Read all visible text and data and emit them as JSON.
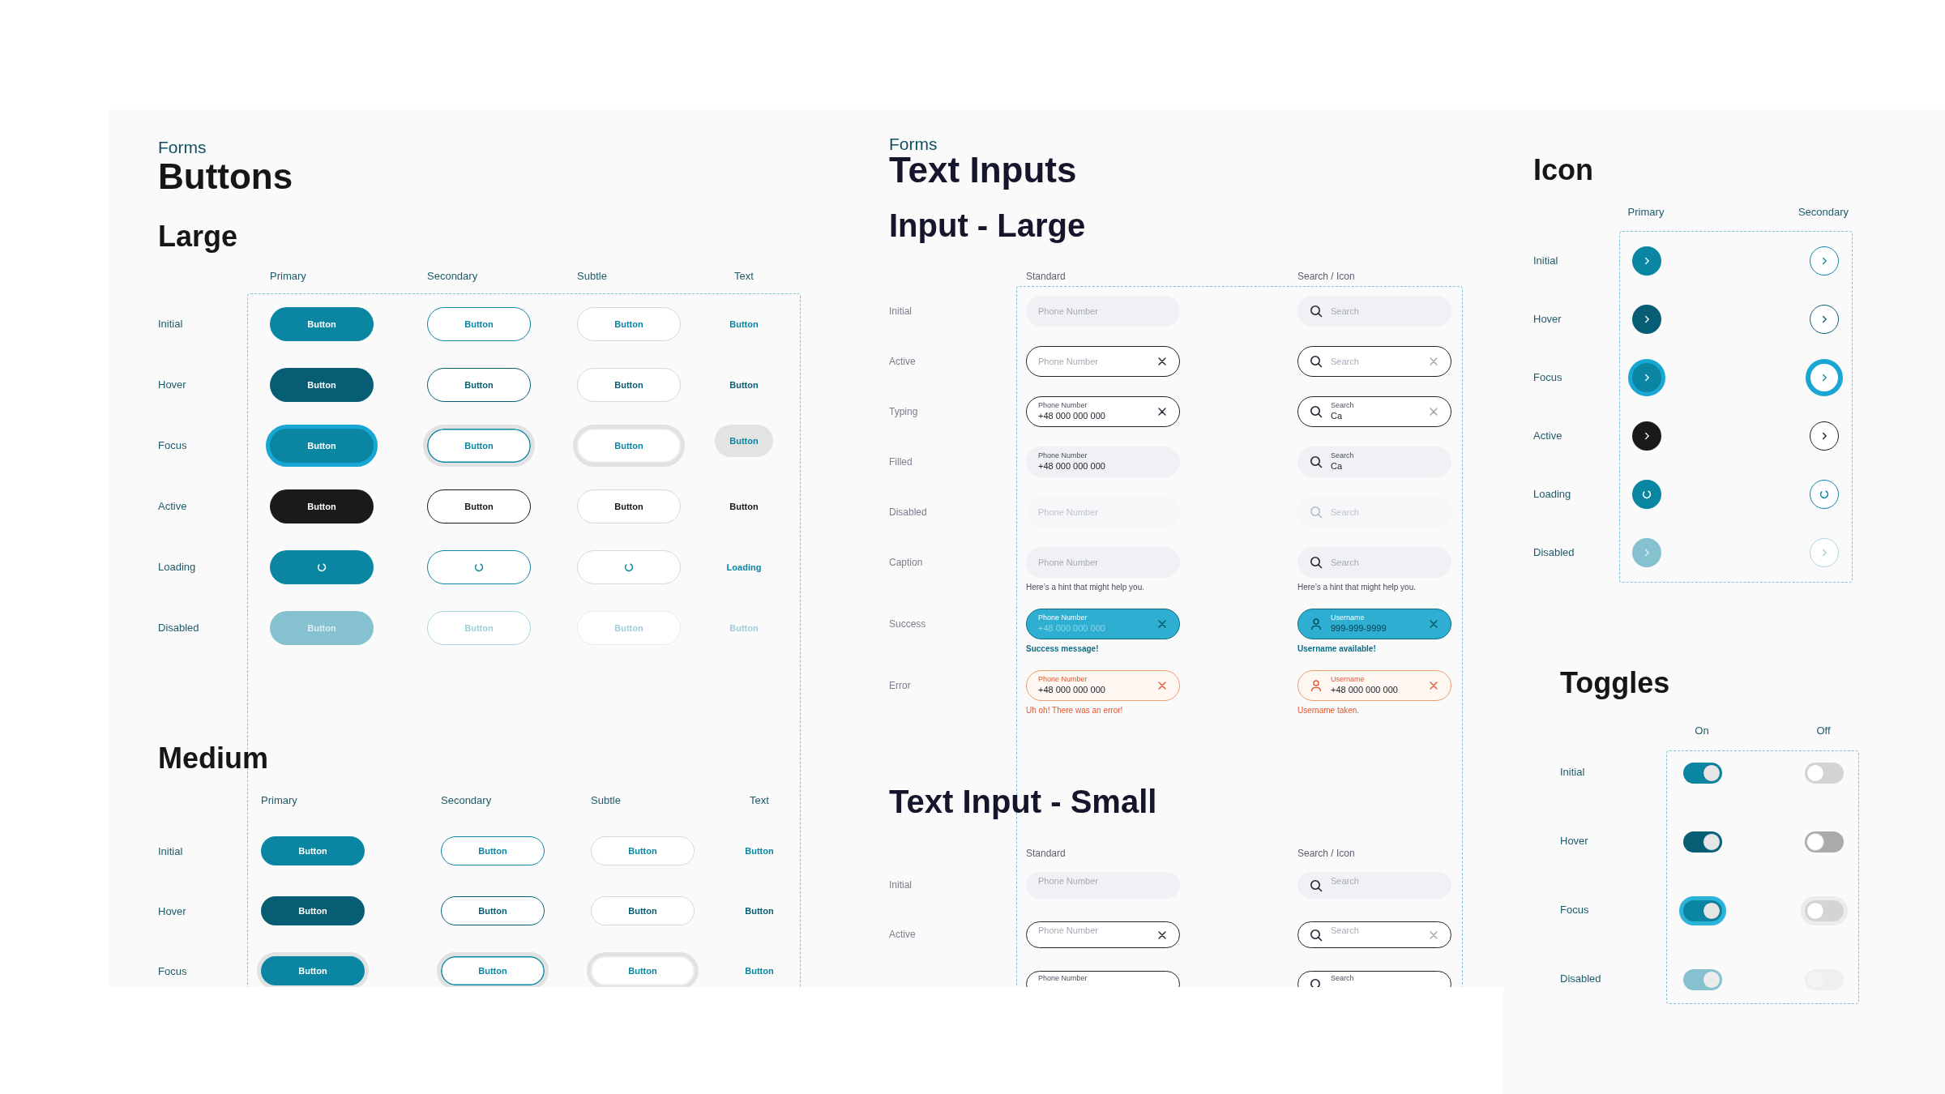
{
  "buttons": {
    "eyebrow": "Forms",
    "title": "Buttons",
    "sizes": [
      {
        "kind": "large",
        "title": "Large",
        "columns": [
          "Primary",
          "Secondary",
          "Subtle",
          "Text"
        ],
        "rows": [
          {
            "kind": "initial",
            "label": "Initial",
            "cells": [
              {
                "kind": "primary",
                "text": "Button"
              },
              {
                "kind": "secondary",
                "text": "Button"
              },
              {
                "kind": "subtle",
                "text": "Button"
              },
              {
                "kind": "text",
                "text": "Button"
              }
            ]
          },
          {
            "kind": "hover",
            "label": "Hover",
            "cells": [
              {
                "kind": "primary",
                "text": "Button"
              },
              {
                "kind": "secondary",
                "text": "Button"
              },
              {
                "kind": "subtle",
                "text": "Button"
              },
              {
                "kind": "text",
                "text": "Button"
              }
            ]
          },
          {
            "kind": "focus",
            "label": "Focus",
            "cells": [
              {
                "kind": "primary",
                "text": "Button"
              },
              {
                "kind": "secondary",
                "text": "Button"
              },
              {
                "kind": "subtle",
                "text": "Button"
              },
              {
                "kind": "text",
                "text": "Button"
              }
            ]
          },
          {
            "kind": "active",
            "label": "Active",
            "cells": [
              {
                "kind": "primary",
                "text": "Button"
              },
              {
                "kind": "secondary",
                "text": "Button"
              },
              {
                "kind": "subtle",
                "text": "Button"
              },
              {
                "kind": "text",
                "text": "Button"
              }
            ]
          },
          {
            "kind": "loading",
            "label": "Loading",
            "cells": [
              {
                "kind": "primary"
              },
              {
                "kind": "secondary"
              },
              {
                "kind": "subtle"
              },
              {
                "kind": "text",
                "text": "Loading"
              }
            ]
          },
          {
            "kind": "disabled",
            "label": "Disabled",
            "cells": [
              {
                "kind": "primary",
                "text": "Button"
              },
              {
                "kind": "secondary",
                "text": "Button"
              },
              {
                "kind": "subtle",
                "text": "Button"
              },
              {
                "kind": "text",
                "text": "Button"
              }
            ]
          }
        ]
      },
      {
        "kind": "medium",
        "title": "Medium",
        "columns": [
          "Primary",
          "Secondary",
          "Subtle",
          "Text"
        ],
        "rows": [
          {
            "kind": "initial",
            "label": "Initial",
            "cells": [
              {
                "kind": "primary",
                "text": "Button"
              },
              {
                "kind": "secondary",
                "text": "Button"
              },
              {
                "kind": "subtle",
                "text": "Button"
              },
              {
                "kind": "text",
                "text": "Button"
              }
            ]
          },
          {
            "kind": "hover",
            "label": "Hover",
            "cells": [
              {
                "kind": "primary",
                "text": "Button"
              },
              {
                "kind": "secondary",
                "text": "Button"
              },
              {
                "kind": "subtle",
                "text": "Button"
              },
              {
                "kind": "text",
                "text": "Button"
              }
            ]
          },
          {
            "kind": "focus",
            "label": "Focus",
            "cells": [
              {
                "kind": "primary",
                "text": "Button"
              },
              {
                "kind": "secondary",
                "text": "Button"
              },
              {
                "kind": "subtle",
                "text": "Button"
              },
              {
                "kind": "text",
                "text": "Button"
              }
            ]
          }
        ]
      }
    ]
  },
  "text_inputs": {
    "eyebrow": "Forms",
    "title": "Text Inputs",
    "sections": [
      {
        "kind": "large",
        "title": "Input - Large",
        "columns": [
          "Standard",
          "Search / Icon"
        ],
        "rows": [
          {
            "kind": "initial",
            "label": "Initial",
            "cells": [
              {
                "kind": "plain",
                "placeholder": "Phone Number",
                "clearable": false
              },
              {
                "kind": "search",
                "placeholder": "Search",
                "clearable": false
              }
            ]
          },
          {
            "kind": "active",
            "label": "Active",
            "cells": [
              {
                "kind": "plain",
                "placeholder": "Phone Number",
                "clearable": true
              },
              {
                "kind": "search",
                "placeholder": "Search",
                "clearable": true
              }
            ]
          },
          {
            "kind": "typing",
            "label": "Typing",
            "cells": [
              {
                "kind": "plain",
                "label": "Phone Number",
                "value": "+48 000 000 000",
                "clearable": true
              },
              {
                "kind": "search",
                "label": "Search",
                "value": "Ca",
                "clearable": true
              }
            ]
          },
          {
            "kind": "filled",
            "label": "Filled",
            "cells": [
              {
                "kind": "plain",
                "label": "Phone Number",
                "value": "+48 000 000 000",
                "clearable": false
              },
              {
                "kind": "search",
                "label": "Search",
                "value": "Ca",
                "clearable": false
              }
            ]
          },
          {
            "kind": "disabled",
            "label": "Disabled",
            "cells": [
              {
                "kind": "plain",
                "placeholder": "Phone Number",
                "clearable": false
              },
              {
                "kind": "search",
                "placeholder": "Search",
                "clearable": false
              }
            ]
          },
          {
            "kind": "caption",
            "label": "Caption",
            "cells": [
              {
                "kind": "plain",
                "placeholder": "Phone Number",
                "clearable": false,
                "hint": "Here’s a hint that might help you."
              },
              {
                "kind": "search",
                "placeholder": "Search",
                "clearable": false,
                "hint": "Here’s a hint that might help you."
              }
            ]
          },
          {
            "kind": "success",
            "label": "Success",
            "cells": [
              {
                "kind": "plain",
                "label": "Phone Number",
                "placeholder": "+48 000 000 000",
                "clearable": true,
                "hint": "Success message!"
              },
              {
                "kind": "user",
                "label": "Username",
                "value": "999-999-9999",
                "clearable": true,
                "hint": "Username available!"
              }
            ]
          },
          {
            "kind": "error",
            "label": "Error",
            "cells": [
              {
                "kind": "plain",
                "label": "Phone Number",
                "value": "+48 000 000 000",
                "clearable": true,
                "hint": "Uh oh! There was an error!"
              },
              {
                "kind": "user",
                "label": "Username",
                "value": "+48 000 000 000",
                "clearable": true,
                "hint": "Username taken."
              }
            ]
          }
        ]
      },
      {
        "kind": "small",
        "title": "Text Input - Small",
        "columns": [
          "Standard",
          "Search / Icon"
        ],
        "rows": [
          {
            "kind": "initial",
            "label": "Initial",
            "cells": [
              {
                "kind": "plain",
                "placeholder": "Phone Number",
                "clearable": false
              },
              {
                "kind": "search",
                "placeholder": "Search",
                "clearable": false
              }
            ]
          },
          {
            "kind": "active",
            "label": "Active",
            "cells": [
              {
                "kind": "plain",
                "placeholder": "Phone Number",
                "clearable": true
              },
              {
                "kind": "search",
                "placeholder": "Search",
                "clearable": true
              }
            ]
          },
          {
            "kind": "typing",
            "cells": [
              {
                "kind": "plain",
                "label": "Phone Number"
              },
              {
                "kind": "search",
                "label": "Search"
              }
            ]
          }
        ]
      }
    ]
  },
  "icon_buttons": {
    "title": "Icon",
    "columns": [
      "Primary",
      "Secondary"
    ],
    "rows": [
      {
        "kind": "initial",
        "label": "Initial",
        "cells": [
          {
            "kind": "primary"
          },
          {
            "kind": "secondary"
          }
        ]
      },
      {
        "kind": "hover",
        "label": "Hover",
        "cells": [
          {
            "kind": "primary"
          },
          {
            "kind": "secondary"
          }
        ]
      },
      {
        "kind": "focus",
        "label": "Focus",
        "cells": [
          {
            "kind": "primary"
          },
          {
            "kind": "secondary"
          }
        ]
      },
      {
        "kind": "active",
        "label": "Active",
        "cells": [
          {
            "kind": "primary"
          },
          {
            "kind": "secondary"
          }
        ]
      },
      {
        "kind": "loading",
        "label": "Loading",
        "cells": [
          {
            "kind": "primary"
          },
          {
            "kind": "secondary"
          }
        ]
      },
      {
        "kind": "disabled",
        "label": "Disabled",
        "cells": [
          {
            "kind": "primary"
          },
          {
            "kind": "secondary"
          }
        ]
      }
    ]
  },
  "toggles": {
    "title": "Toggles",
    "columns": [
      "On",
      "Off"
    ],
    "rows": [
      {
        "kind": "initial",
        "label": "Initial",
        "cells": [
          {
            "on": true
          },
          {
            "on": false
          }
        ]
      },
      {
        "kind": "hover",
        "label": "Hover",
        "cells": [
          {
            "on": true
          },
          {
            "on": false
          }
        ]
      },
      {
        "kind": "focus",
        "label": "Focus",
        "cells": [
          {
            "on": true
          },
          {
            "on": false
          }
        ]
      },
      {
        "kind": "disabled",
        "label": "Disabled",
        "cells": [
          {
            "on": true
          },
          {
            "on": false
          }
        ]
      }
    ]
  }
}
